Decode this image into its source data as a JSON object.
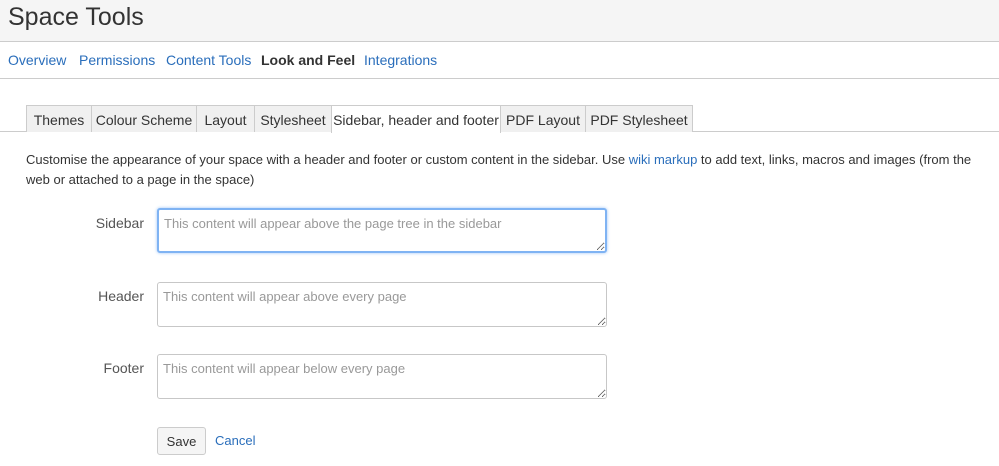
{
  "page": {
    "title": "Space Tools"
  },
  "nav": {
    "items": [
      {
        "label": "Overview"
      },
      {
        "label": "Permissions"
      },
      {
        "label": "Content Tools"
      },
      {
        "label": "Look and Feel"
      },
      {
        "label": "Integrations"
      }
    ],
    "active": "Look and Feel"
  },
  "tabs": {
    "items": [
      {
        "label": "Themes"
      },
      {
        "label": "Colour Scheme"
      },
      {
        "label": "Layout"
      },
      {
        "label": "Stylesheet"
      },
      {
        "label": "Sidebar, header and footer"
      },
      {
        "label": "PDF Layout"
      },
      {
        "label": "PDF Stylesheet"
      }
    ],
    "active": "Sidebar, header and footer"
  },
  "description": {
    "before": "Customise the appearance of your space with a header and footer or custom content in the sidebar. Use ",
    "link": "wiki markup",
    "after": " to add text, links, macros and images (from the web or attached to a page in the space)"
  },
  "form": {
    "sidebar": {
      "label": "Sidebar",
      "placeholder": "This content will appear above the page tree in the sidebar",
      "value": ""
    },
    "header": {
      "label": "Header",
      "placeholder": "This content will appear above every page",
      "value": ""
    },
    "footer": {
      "label": "Footer",
      "placeholder": "This content will appear below every page",
      "value": ""
    },
    "save_label": "Save",
    "cancel_label": "Cancel"
  }
}
